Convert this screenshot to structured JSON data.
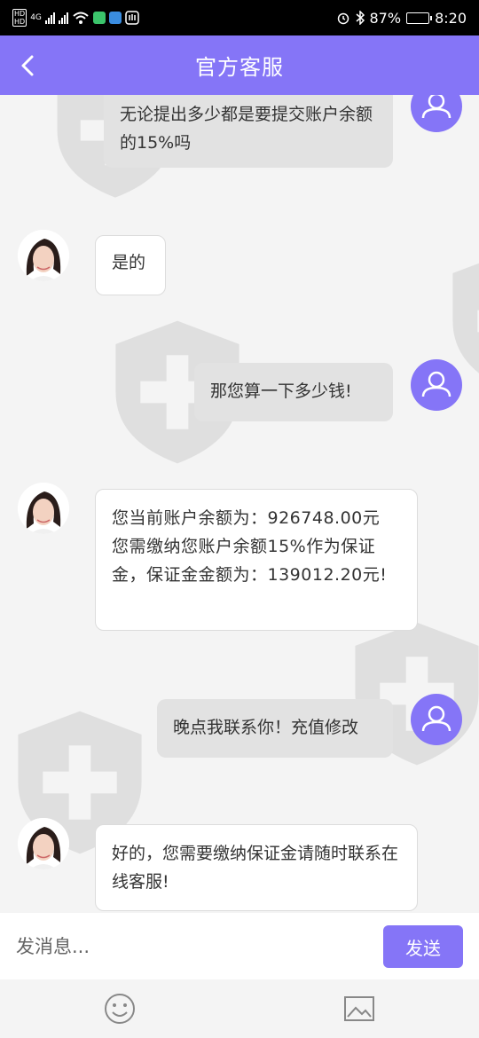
{
  "status_bar": {
    "signal_left": "HD",
    "net_type": "4G",
    "battery": "87%",
    "battery_level": 0.87,
    "time": "8:20"
  },
  "header": {
    "title": "官方客服",
    "accent_color": "#8575f7"
  },
  "messages": [
    {
      "sender": "user",
      "text": "无论提出多少都是要提交账户余额的15%吗"
    },
    {
      "sender": "agent",
      "text": "是的"
    },
    {
      "sender": "user",
      "text": "那您算一下多少钱!"
    },
    {
      "sender": "agent",
      "text": "您当前账户余额为：926748.00元 您需缴纳您账户余额15%作为保证金，保证金金额为：139012.20元!"
    },
    {
      "sender": "user",
      "text": "晚点我联系你！充值修改"
    },
    {
      "sender": "agent",
      "text": "好的，您需要缴纳保证金请随时联系在线客服!"
    }
  ],
  "composer": {
    "placeholder": "发消息...",
    "send_label": "发送"
  },
  "tools": {
    "emoji_icon": "smiley-icon",
    "image_icon": "image-icon"
  }
}
